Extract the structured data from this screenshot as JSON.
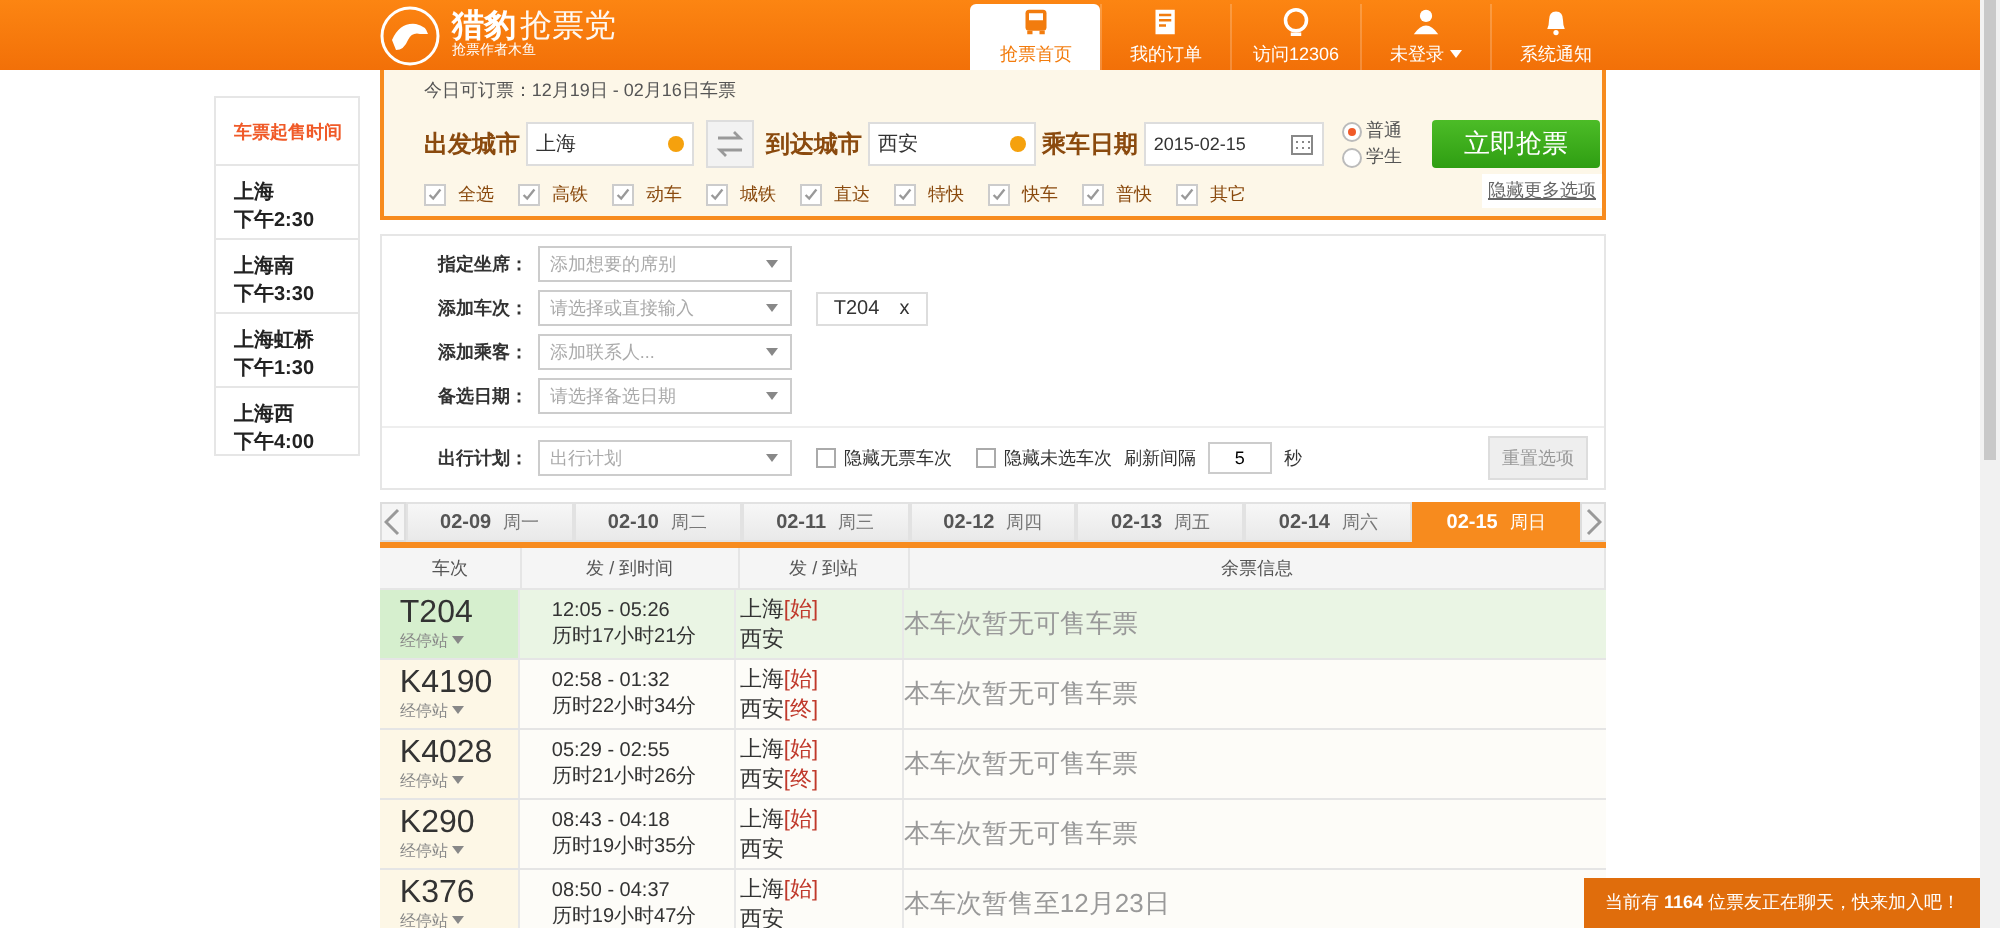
{
  "brand": {
    "name": "猎豹",
    "name_light": "抢票党",
    "tagline": "抢票作者木鱼"
  },
  "nav": [
    {
      "label": "抢票首页",
      "selected": true,
      "dropdown": false
    },
    {
      "label": "我的订单",
      "selected": false,
      "dropdown": false
    },
    {
      "label": "访问12306",
      "selected": false,
      "dropdown": false
    },
    {
      "label": "未登录",
      "selected": false,
      "dropdown": true
    },
    {
      "label": "系统通知",
      "selected": false,
      "dropdown": false
    }
  ],
  "sale_times": {
    "title": "车票起售时间",
    "items": [
      {
        "station": "上海",
        "time": "下午2:30"
      },
      {
        "station": "上海南",
        "time": "下午3:30"
      },
      {
        "station": "上海虹桥",
        "time": "下午1:30"
      },
      {
        "station": "上海西",
        "time": "下午4:00"
      }
    ]
  },
  "search": {
    "notice": "今日可订票：12月19日 - 02月16日车票",
    "from_label": "出发城市",
    "from": "上海",
    "to_label": "到达城市",
    "to": "西安",
    "date_label": "乘车日期",
    "date": "2015-02-15",
    "ticket_types": [
      {
        "label": "普通",
        "selected": true
      },
      {
        "label": "学生",
        "selected": false
      }
    ],
    "submit": "立即抢票",
    "train_types": [
      {
        "label": "全选",
        "checked": true
      },
      {
        "label": "高铁",
        "checked": true
      },
      {
        "label": "动车",
        "checked": true
      },
      {
        "label": "城铁",
        "checked": true
      },
      {
        "label": "直达",
        "checked": true
      },
      {
        "label": "特快",
        "checked": true
      },
      {
        "label": "快车",
        "checked": true
      },
      {
        "label": "普快",
        "checked": true
      },
      {
        "label": "其它",
        "checked": true
      }
    ],
    "more_link": "隐藏更多选项"
  },
  "options": {
    "fields": [
      {
        "label": "指定坐席：",
        "placeholder": "添加想要的席别"
      },
      {
        "label": "添加车次：",
        "placeholder": "请选择或直接输入",
        "tags": [
          "T204"
        ]
      },
      {
        "label": "添加乘客：",
        "placeholder": "添加联系人..."
      },
      {
        "label": "备选日期：",
        "placeholder": "请选择备选日期"
      }
    ],
    "plan_label": "出行计划：",
    "plan_placeholder": "出行计划",
    "hide_no_ticket": {
      "label": "隐藏无票车次",
      "checked": false
    },
    "hide_unselected": {
      "label": "隐藏未选车次",
      "checked": false
    },
    "refresh_label": "刷新间隔",
    "refresh_value": "5",
    "refresh_unit": "秒",
    "reset": "重置选项",
    "tag_remove": "x"
  },
  "dates": [
    {
      "date": "02-09",
      "weekday": "周一",
      "selected": false
    },
    {
      "date": "02-10",
      "weekday": "周二",
      "selected": false
    },
    {
      "date": "02-11",
      "weekday": "周三",
      "selected": false
    },
    {
      "date": "02-12",
      "weekday": "周四",
      "selected": false
    },
    {
      "date": "02-13",
      "weekday": "周五",
      "selected": false
    },
    {
      "date": "02-14",
      "weekday": "周六",
      "selected": false
    },
    {
      "date": "02-15",
      "weekday": "周日",
      "selected": true
    }
  ],
  "table": {
    "columns": [
      "车次",
      "发 / 到时间",
      "发 / 到站",
      "余票信息"
    ],
    "rows": [
      {
        "train": "T204",
        "stops": "经停站",
        "times": "12:05 - 05:26",
        "duration": "历时17小时21分",
        "from": "上海",
        "from_tag": "[始]",
        "to": "西安",
        "to_tag": "",
        "info": "本车次暂无可售车票",
        "selected": true
      },
      {
        "train": "K4190",
        "stops": "经停站",
        "times": "02:58 - 01:32",
        "duration": "历时22小时34分",
        "from": "上海",
        "from_tag": "[始]",
        "to": "西安",
        "to_tag": "[终]",
        "info": "本车次暂无可售车票",
        "selected": false
      },
      {
        "train": "K4028",
        "stops": "经停站",
        "times": "05:29 - 02:55",
        "duration": "历时21小时26分",
        "from": "上海",
        "from_tag": "[始]",
        "to": "西安",
        "to_tag": "[终]",
        "info": "本车次暂无可售车票",
        "selected": false
      },
      {
        "train": "K290",
        "stops": "经停站",
        "times": "08:43 - 04:18",
        "duration": "历时19小时35分",
        "from": "上海",
        "from_tag": "[始]",
        "to": "西安",
        "to_tag": "",
        "info": "本车次暂无可售车票",
        "selected": false
      },
      {
        "train": "K376",
        "stops": "经停站",
        "times": "08:50 - 04:37",
        "duration": "历时19小时47分",
        "from": "上海",
        "from_tag": "[始]",
        "to": "西安",
        "to_tag": "",
        "info": "本车次暂售至12月23日",
        "selected": false
      }
    ]
  },
  "chat_bar": "当前有 **1164** 位票友正在聊天，快来加入吧！"
}
